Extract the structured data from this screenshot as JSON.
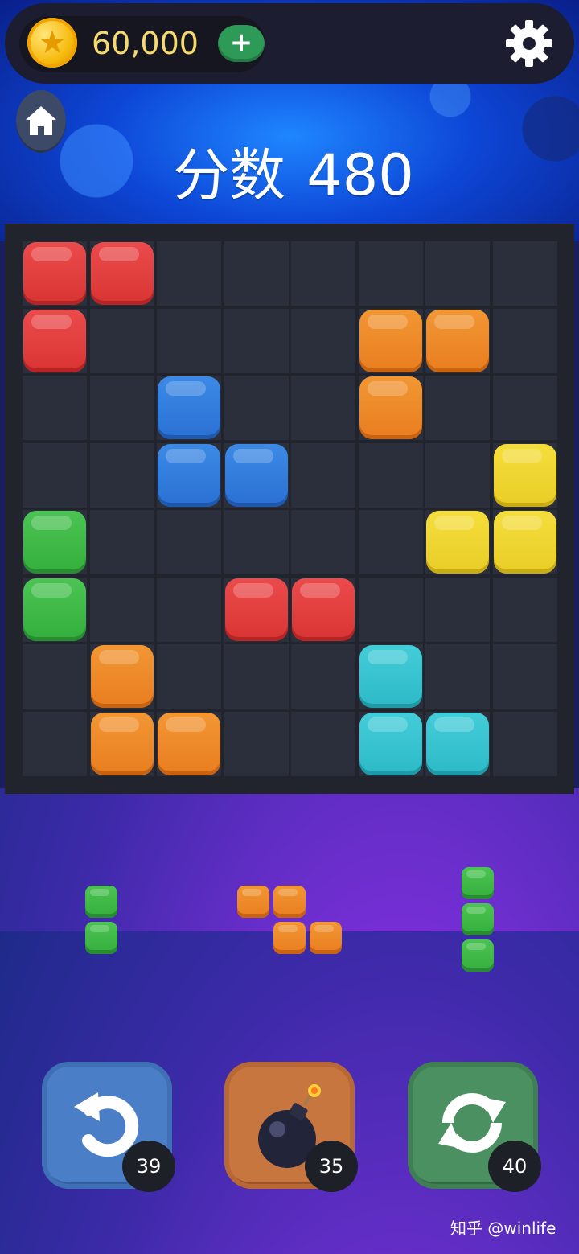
{
  "header": {
    "coins": "60,000",
    "add_coins_label": "+",
    "settings_icon": "gear-icon",
    "home_icon": "home-icon"
  },
  "score": {
    "label": "分数",
    "value": "480"
  },
  "colors": {
    "red": "#e03b3b",
    "orange": "#ee8a27",
    "blue": "#2f7bdc",
    "yellow": "#eed42f",
    "green": "#3cb944",
    "cyan": "#37c3cf"
  },
  "board": {
    "size": 8,
    "rows": [
      [
        "red",
        "red",
        null,
        null,
        null,
        null,
        null,
        null
      ],
      [
        "red",
        null,
        null,
        null,
        null,
        "orange",
        "orange",
        null
      ],
      [
        null,
        null,
        "blue",
        null,
        null,
        "orange",
        null,
        null
      ],
      [
        null,
        null,
        "blue",
        "blue",
        null,
        null,
        null,
        "yellow"
      ],
      [
        "green",
        null,
        null,
        null,
        null,
        null,
        "yellow",
        "yellow"
      ],
      [
        "green",
        null,
        null,
        "red",
        "red",
        null,
        null,
        null
      ],
      [
        null,
        "orange",
        null,
        null,
        null,
        "cyan",
        null,
        null
      ],
      [
        null,
        "orange",
        "orange",
        null,
        null,
        "cyan",
        "cyan",
        null
      ]
    ]
  },
  "pieces": [
    {
      "color": "green",
      "cells": [
        [
          0,
          0
        ],
        [
          1,
          0
        ]
      ]
    },
    {
      "color": "orange",
      "cells": [
        [
          0,
          0
        ],
        [
          0,
          1
        ],
        [
          1,
          1
        ],
        [
          1,
          2
        ]
      ]
    },
    {
      "color": "green",
      "cells": [
        [
          0,
          0
        ],
        [
          1,
          0
        ],
        [
          2,
          0
        ]
      ]
    }
  ],
  "powerups": [
    {
      "name": "undo",
      "icon": "undo-icon",
      "count": "39"
    },
    {
      "name": "bomb",
      "icon": "bomb-icon",
      "count": "35"
    },
    {
      "name": "refresh",
      "icon": "refresh-icon",
      "count": "40"
    }
  ],
  "watermark": "知乎 @winlife"
}
